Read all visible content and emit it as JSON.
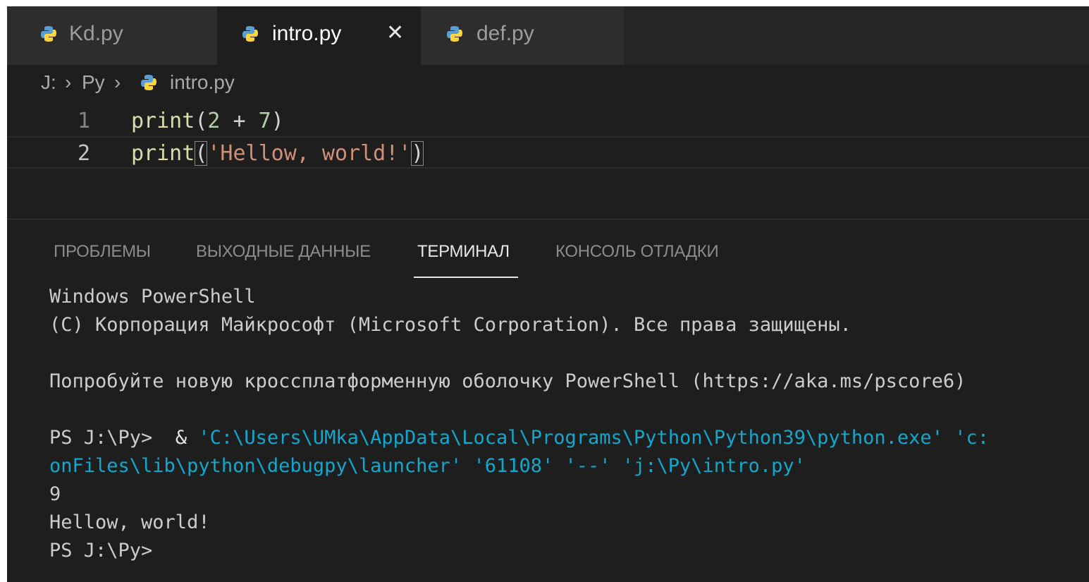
{
  "colors": {
    "editor_bg": "#1e1e1e",
    "tabbar_bg": "#252526",
    "inactive_tab_bg": "#2d2d2d",
    "keyword_fn": "#dcdcaa",
    "number": "#b5cea8",
    "string": "#ce9178",
    "terminal_path": "#11a8cd"
  },
  "tabs": [
    {
      "label": "Kd.py",
      "icon": "python-icon",
      "active": false
    },
    {
      "label": "intro.py",
      "icon": "python-icon",
      "active": true,
      "close": "✕"
    },
    {
      "label": "def.py",
      "icon": "python-icon",
      "active": false
    }
  ],
  "breadcrumb": {
    "drive": "J:",
    "sep1": "›",
    "folder": "Py",
    "sep2": "›",
    "file": "intro.py"
  },
  "editor": {
    "lines": [
      {
        "number": "1",
        "fn": "print",
        "open": "(",
        "arg1": "2",
        "op": " + ",
        "arg2": "7",
        "close": ")"
      },
      {
        "number": "2",
        "fn": "print",
        "open": "(",
        "str": "'Hellow, world!'",
        "close": ")"
      }
    ]
  },
  "panel": {
    "tabs": [
      "ПРОБЛЕМЫ",
      "ВЫХОДНЫЕ ДАННЫЕ",
      "ТЕРМИНАЛ",
      "КОНСОЛЬ ОТЛАДКИ"
    ],
    "active_tab": "ТЕРМИНАЛ"
  },
  "terminal": {
    "line1": "Windows PowerShell",
    "line2": "(C) Корпорация Майкрософт (Microsoft Corporation). Все права защищены.",
    "line3": "Попробуйте новую кроссплатформенную оболочку PowerShell (https://aka.ms/pscore6)",
    "prompt1": "PS J:\\Py> ",
    "amp": " & ",
    "cmd1": "'C:\\Users\\UMka\\AppData\\Local\\Programs\\Python\\Python39\\python.exe' 'c:",
    "cmd2": "onFiles\\lib\\python\\debugpy\\launcher' '61108' '--' 'j:\\Py\\intro.py'",
    "out1": "9",
    "out2": "Hellow, world!",
    "prompt2": "PS J:\\Py>"
  }
}
